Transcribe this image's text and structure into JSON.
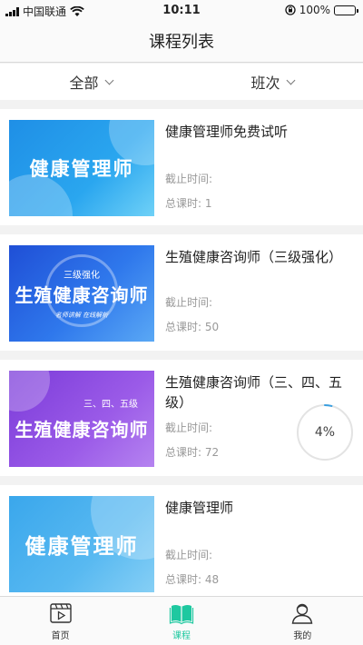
{
  "status_bar": {
    "carrier": "中国联通",
    "time": "10:11",
    "battery": "100%"
  },
  "nav": {
    "title": "课程列表"
  },
  "filters": {
    "all_label": "全部",
    "class_label": "班次"
  },
  "courses": [
    {
      "title": "健康管理师免费试听",
      "deadline_label": "截止时间:",
      "hours_label": "总课时: 1",
      "thumb_text": "健康管理师",
      "thumb_tag": "",
      "thumb_sub": ""
    },
    {
      "title": "生殖健康咨询师（三级强化）",
      "deadline_label": "截止时间:",
      "hours_label": "总课时: 50",
      "thumb_text": "生殖健康咨询师",
      "thumb_tag": "三级强化",
      "thumb_sub": "名师讲解  在线解析"
    },
    {
      "title": "生殖健康咨询师（三、四、五级）",
      "deadline_label": "截止时间:",
      "hours_label": "总课时: 72",
      "thumb_text": "生殖健康咨询师",
      "thumb_tag": "三、四、五级",
      "thumb_sub": "",
      "progress": "4%",
      "progress_value": 0.04
    },
    {
      "title": "健康管理师",
      "deadline_label": "截止时间:",
      "hours_label": "总课时: 48",
      "thumb_text": "健康管理师",
      "thumb_tag": "",
      "thumb_sub": ""
    }
  ],
  "tabs": [
    {
      "label": "首页",
      "icon": "video-icon"
    },
    {
      "label": "课程",
      "icon": "book-icon"
    },
    {
      "label": "我的",
      "icon": "user-icon"
    }
  ],
  "colors": {
    "accent": "#1ec8a0",
    "progress_ring": "#3a9fe0"
  }
}
